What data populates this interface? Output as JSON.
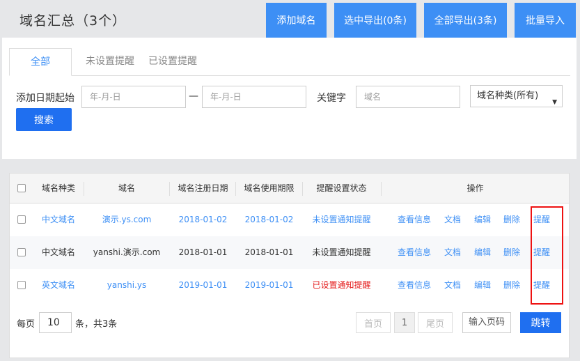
{
  "header": {
    "title": "域名汇总（3个）",
    "buttons": {
      "add_domain": "添加域名",
      "export_selected": "选中导出(0条)",
      "export_all": "全部导出(3条)",
      "batch_import": "批量导入"
    }
  },
  "tabs": {
    "all": "全部",
    "not_set": "未设置提醒",
    "set": "已设置提醒"
  },
  "filters": {
    "date_label": "添加日期起始",
    "date_start_placeholder": "年-月-日",
    "date_sep": "—",
    "date_end_placeholder": "年-月-日",
    "keyword_label": "关键字",
    "keyword_placeholder": "域名",
    "type_select": "域名种类(所有)",
    "search_button": "搜索"
  },
  "table": {
    "columns": {
      "type": "域名种类",
      "domain": "域名",
      "reg_date": "域名注册日期",
      "expire": "域名使用期限",
      "remind_status": "提醒设置状态",
      "actions": "操作"
    },
    "rows": [
      {
        "type": "中文域名",
        "domain": "演示.ys.com",
        "reg_date": "2018-01-02",
        "expire": "2018-01-02",
        "status": "未设置通知提醒",
        "view": "查看信息",
        "doc": "文档",
        "edit": "编辑",
        "delete": "删除",
        "remind": "提醒"
      },
      {
        "type": "中文域名",
        "domain": "yanshi.演示.com",
        "reg_date": "2018-01-01",
        "expire": "2018-01-01",
        "status": "未设置通知提醒",
        "view": "查看信息",
        "doc": "文档",
        "edit": "编辑",
        "delete": "删除",
        "remind": "提醒"
      },
      {
        "type": "英文域名",
        "domain": "yanshi.ys",
        "reg_date": "2019-01-01",
        "expire": "2019-01-01",
        "status": "已设置通知提醒",
        "view": "查看信息",
        "doc": "文档",
        "edit": "编辑",
        "delete": "删除",
        "remind": "提醒"
      }
    ]
  },
  "pagination": {
    "per_page_label": "每页",
    "per_page_value": "10",
    "total_text": "条，共3条",
    "first": "首页",
    "current": "1",
    "last": "尾页",
    "jump_placeholder": "输入页码",
    "jump_button": "跳转"
  },
  "colors": {
    "accent": "#3d8ff5",
    "primary_button": "#1f6ff0",
    "status_set": "#e41c1c",
    "highlight_box": "#e11111"
  }
}
